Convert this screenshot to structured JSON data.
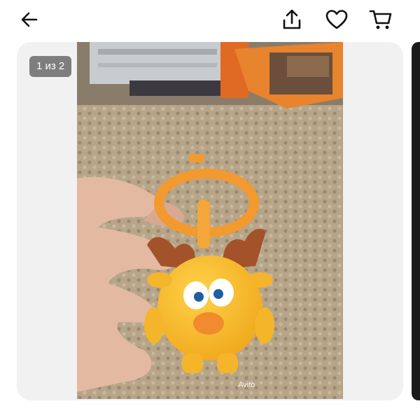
{
  "header": {
    "back_icon": "arrow-left-icon",
    "share_icon": "share-upload-icon",
    "favorite_icon": "heart-outline-icon",
    "cart_icon": "shopping-cart-icon"
  },
  "gallery": {
    "counter": "1 из 2",
    "watermark": "Avito"
  },
  "colors": {
    "background": "#ffffff",
    "gallery_bg": "#f1f1f1",
    "counter_bg": "#646464",
    "icon": "#111111"
  }
}
